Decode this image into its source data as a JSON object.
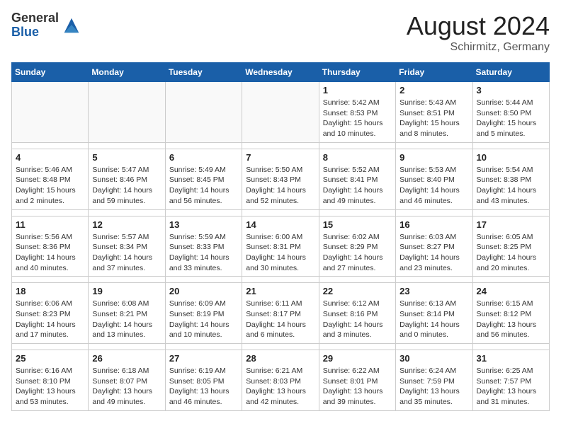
{
  "header": {
    "logo_general": "General",
    "logo_blue": "Blue",
    "month_title": "August 2024",
    "location": "Schirmitz, Germany"
  },
  "days_of_week": [
    "Sunday",
    "Monday",
    "Tuesday",
    "Wednesday",
    "Thursday",
    "Friday",
    "Saturday"
  ],
  "weeks": [
    [
      {
        "day": "",
        "sunrise": "",
        "sunset": "",
        "daylight": ""
      },
      {
        "day": "",
        "sunrise": "",
        "sunset": "",
        "daylight": ""
      },
      {
        "day": "",
        "sunrise": "",
        "sunset": "",
        "daylight": ""
      },
      {
        "day": "",
        "sunrise": "",
        "sunset": "",
        "daylight": ""
      },
      {
        "day": "1",
        "sunrise": "5:42 AM",
        "sunset": "8:53 PM",
        "daylight": "15 hours and 10 minutes."
      },
      {
        "day": "2",
        "sunrise": "5:43 AM",
        "sunset": "8:51 PM",
        "daylight": "15 hours and 8 minutes."
      },
      {
        "day": "3",
        "sunrise": "5:44 AM",
        "sunset": "8:50 PM",
        "daylight": "15 hours and 5 minutes."
      }
    ],
    [
      {
        "day": "4",
        "sunrise": "5:46 AM",
        "sunset": "8:48 PM",
        "daylight": "15 hours and 2 minutes."
      },
      {
        "day": "5",
        "sunrise": "5:47 AM",
        "sunset": "8:46 PM",
        "daylight": "14 hours and 59 minutes."
      },
      {
        "day": "6",
        "sunrise": "5:49 AM",
        "sunset": "8:45 PM",
        "daylight": "14 hours and 56 minutes."
      },
      {
        "day": "7",
        "sunrise": "5:50 AM",
        "sunset": "8:43 PM",
        "daylight": "14 hours and 52 minutes."
      },
      {
        "day": "8",
        "sunrise": "5:52 AM",
        "sunset": "8:41 PM",
        "daylight": "14 hours and 49 minutes."
      },
      {
        "day": "9",
        "sunrise": "5:53 AM",
        "sunset": "8:40 PM",
        "daylight": "14 hours and 46 minutes."
      },
      {
        "day": "10",
        "sunrise": "5:54 AM",
        "sunset": "8:38 PM",
        "daylight": "14 hours and 43 minutes."
      }
    ],
    [
      {
        "day": "11",
        "sunrise": "5:56 AM",
        "sunset": "8:36 PM",
        "daylight": "14 hours and 40 minutes."
      },
      {
        "day": "12",
        "sunrise": "5:57 AM",
        "sunset": "8:34 PM",
        "daylight": "14 hours and 37 minutes."
      },
      {
        "day": "13",
        "sunrise": "5:59 AM",
        "sunset": "8:33 PM",
        "daylight": "14 hours and 33 minutes."
      },
      {
        "day": "14",
        "sunrise": "6:00 AM",
        "sunset": "8:31 PM",
        "daylight": "14 hours and 30 minutes."
      },
      {
        "day": "15",
        "sunrise": "6:02 AM",
        "sunset": "8:29 PM",
        "daylight": "14 hours and 27 minutes."
      },
      {
        "day": "16",
        "sunrise": "6:03 AM",
        "sunset": "8:27 PM",
        "daylight": "14 hours and 23 minutes."
      },
      {
        "day": "17",
        "sunrise": "6:05 AM",
        "sunset": "8:25 PM",
        "daylight": "14 hours and 20 minutes."
      }
    ],
    [
      {
        "day": "18",
        "sunrise": "6:06 AM",
        "sunset": "8:23 PM",
        "daylight": "14 hours and 17 minutes."
      },
      {
        "day": "19",
        "sunrise": "6:08 AM",
        "sunset": "8:21 PM",
        "daylight": "14 hours and 13 minutes."
      },
      {
        "day": "20",
        "sunrise": "6:09 AM",
        "sunset": "8:19 PM",
        "daylight": "14 hours and 10 minutes."
      },
      {
        "day": "21",
        "sunrise": "6:11 AM",
        "sunset": "8:17 PM",
        "daylight": "14 hours and 6 minutes."
      },
      {
        "day": "22",
        "sunrise": "6:12 AM",
        "sunset": "8:16 PM",
        "daylight": "14 hours and 3 minutes."
      },
      {
        "day": "23",
        "sunrise": "6:13 AM",
        "sunset": "8:14 PM",
        "daylight": "14 hours and 0 minutes."
      },
      {
        "day": "24",
        "sunrise": "6:15 AM",
        "sunset": "8:12 PM",
        "daylight": "13 hours and 56 minutes."
      }
    ],
    [
      {
        "day": "25",
        "sunrise": "6:16 AM",
        "sunset": "8:10 PM",
        "daylight": "13 hours and 53 minutes."
      },
      {
        "day": "26",
        "sunrise": "6:18 AM",
        "sunset": "8:07 PM",
        "daylight": "13 hours and 49 minutes."
      },
      {
        "day": "27",
        "sunrise": "6:19 AM",
        "sunset": "8:05 PM",
        "daylight": "13 hours and 46 minutes."
      },
      {
        "day": "28",
        "sunrise": "6:21 AM",
        "sunset": "8:03 PM",
        "daylight": "13 hours and 42 minutes."
      },
      {
        "day": "29",
        "sunrise": "6:22 AM",
        "sunset": "8:01 PM",
        "daylight": "13 hours and 39 minutes."
      },
      {
        "day": "30",
        "sunrise": "6:24 AM",
        "sunset": "7:59 PM",
        "daylight": "13 hours and 35 minutes."
      },
      {
        "day": "31",
        "sunrise": "6:25 AM",
        "sunset": "7:57 PM",
        "daylight": "13 hours and 31 minutes."
      }
    ]
  ],
  "labels": {
    "sunrise": "Sunrise:",
    "sunset": "Sunset:",
    "daylight": "Daylight:"
  }
}
